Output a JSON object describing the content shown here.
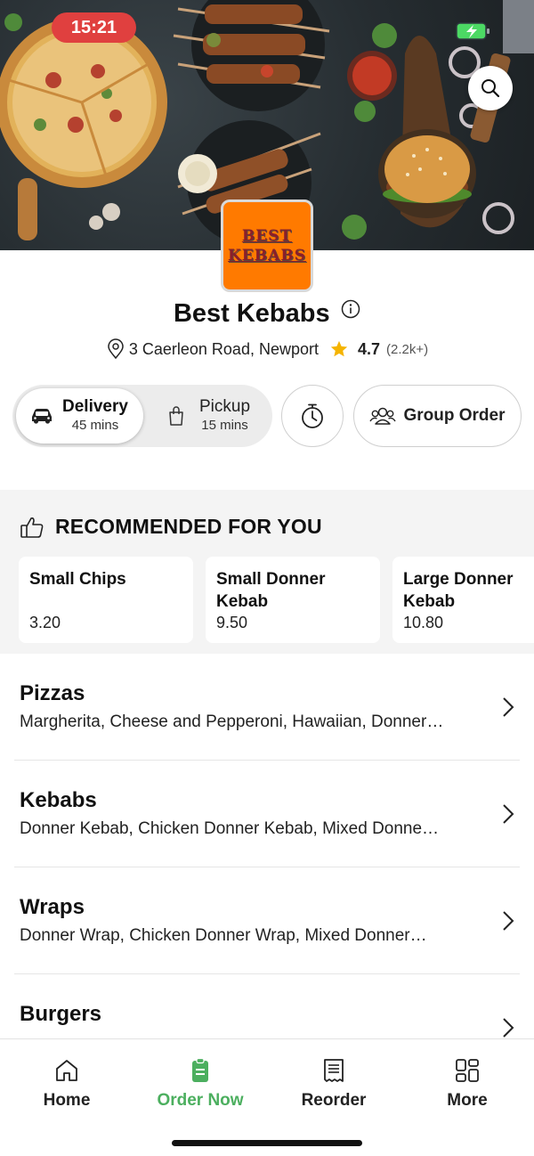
{
  "status_bar": {
    "time": "15:21"
  },
  "restaurant": {
    "logo_line1": "BEST",
    "logo_line2": "KEBABS",
    "name": "Best Kebabs",
    "address": "3 Caerleon Road, Newport",
    "rating": "4.7",
    "rating_count": "(2.2k+)"
  },
  "modes": {
    "delivery": {
      "label": "Delivery",
      "time": "45 mins",
      "selected": true
    },
    "pickup": {
      "label": "Pickup",
      "time": "15 mins",
      "selected": false
    },
    "group_order": "Group Order"
  },
  "recommended": {
    "title": "RECOMMENDED FOR YOU",
    "items": [
      {
        "name": "Small Chips",
        "price": "3.20"
      },
      {
        "name": "Small Donner Kebab",
        "price": "9.50"
      },
      {
        "name": "Large Donner Kebab",
        "price": "10.80"
      }
    ]
  },
  "categories": [
    {
      "name": "Pizzas",
      "description": "Margherita, Cheese and Pepperoni, Hawaiian, Donner…"
    },
    {
      "name": "Kebabs",
      "description": "Donner Kebab, Chicken Donner Kebab, Mixed Donne…"
    },
    {
      "name": "Wraps",
      "description": "Donner Wrap, Chicken Donner Wrap, Mixed Donner…"
    },
    {
      "name": "Burgers",
      "description": ""
    }
  ],
  "bottom_nav": [
    {
      "label": "Home",
      "icon": "home-icon",
      "active": false
    },
    {
      "label": "Order Now",
      "icon": "order-icon",
      "active": true
    },
    {
      "label": "Reorder",
      "icon": "receipt-icon",
      "active": false
    },
    {
      "label": "More",
      "icon": "grid-icon",
      "active": false
    }
  ],
  "colors": {
    "accent_green": "#4caf5f",
    "logo_orange": "#ff7a00",
    "status_red": "#e0403f",
    "star_yellow": "#f5b400"
  }
}
